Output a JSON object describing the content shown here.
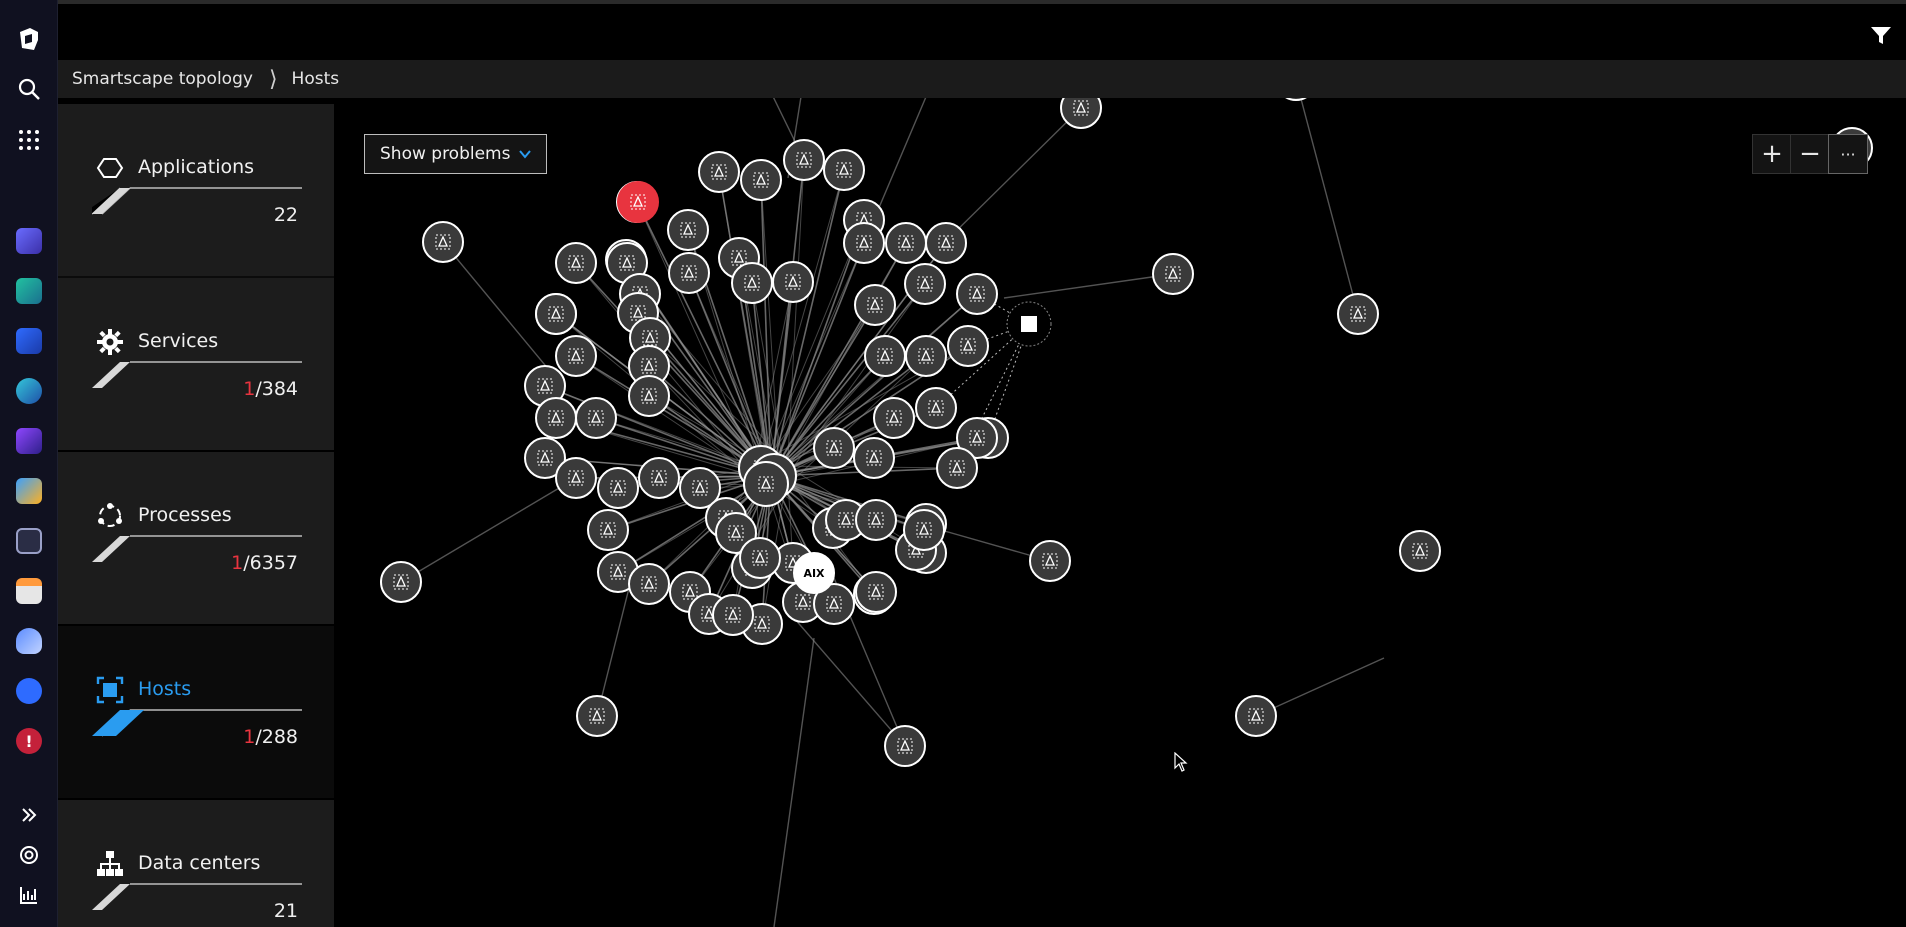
{
  "breadcrumb": {
    "root": "Smartscape topology",
    "current": "Hosts"
  },
  "sidebar": {
    "items": [
      {
        "label": "Applications",
        "problems": "",
        "total": "22",
        "icon": "hexagon-icon"
      },
      {
        "label": "Services",
        "problems": "1",
        "total": "/384",
        "icon": "gear-icon"
      },
      {
        "label": "Processes",
        "problems": "1",
        "total": "/6357",
        "icon": "process-ring-icon"
      },
      {
        "label": "Hosts",
        "problems": "1",
        "total": "/288",
        "icon": "host-icon",
        "active": true
      },
      {
        "label": "Data centers",
        "problems": "",
        "total": "21",
        "icon": "hierarchy-icon"
      }
    ]
  },
  "map": {
    "dropdown_label": "Show problems",
    "zoom_in": "+",
    "zoom_out": "−",
    "more": "···",
    "aix_label": "AIX"
  },
  "colors": {
    "accent": "#2a9cf0",
    "error": "#e8343f",
    "node_fill": "#3a3a3a",
    "node_stroke": "#ffffff",
    "edge": "#8a8a8a"
  }
}
